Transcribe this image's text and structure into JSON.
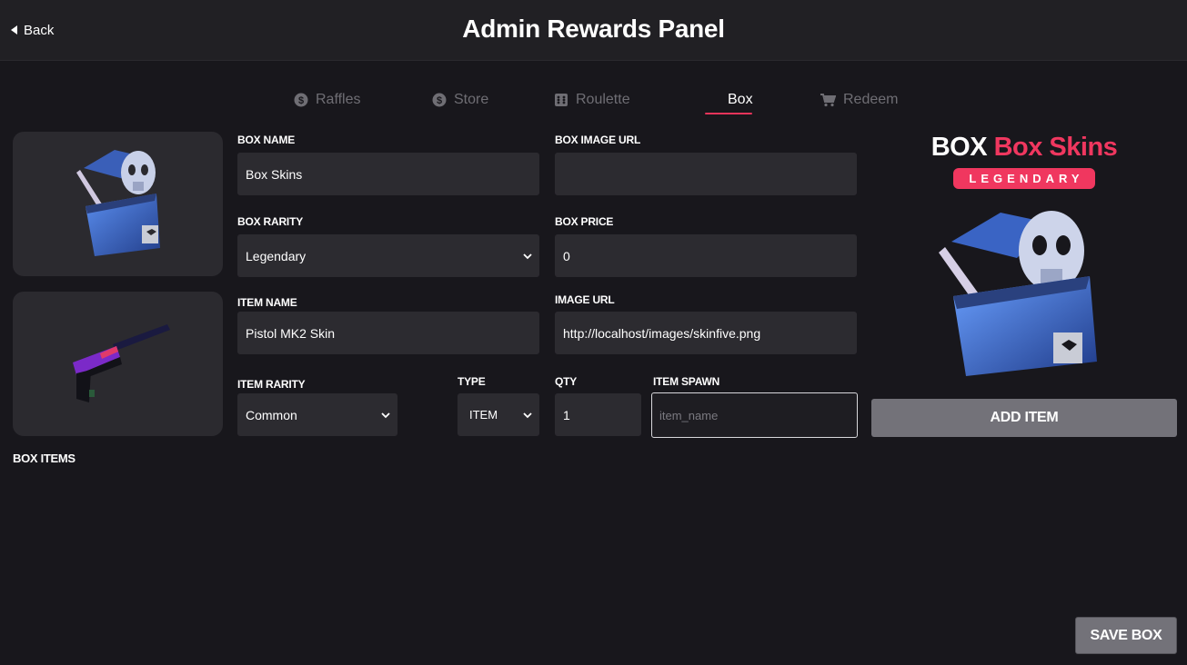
{
  "header": {
    "back_label": "Back",
    "title": "Admin Rewards Panel"
  },
  "tabs": [
    {
      "label": "Raffles",
      "icon": "dollar-coin-icon",
      "active": false
    },
    {
      "label": "Store",
      "icon": "dollar-coin-icon",
      "active": false
    },
    {
      "label": "Roulette",
      "icon": "dice-icon",
      "active": false
    },
    {
      "label": "Box",
      "icon": "",
      "active": true
    },
    {
      "label": "Redeem",
      "icon": "cart-icon",
      "active": false
    }
  ],
  "form": {
    "box_name": {
      "label": "BOX NAME",
      "value": "Box Skins"
    },
    "box_image_url": {
      "label": "BOX IMAGE URL",
      "value": ""
    },
    "box_rarity": {
      "label": "BOX RARITY",
      "value": "Legendary"
    },
    "box_price": {
      "label": "BOX PRICE",
      "value": "0"
    },
    "item_name": {
      "label": "ITEM NAME",
      "value": "Pistol MK2 Skin"
    },
    "image_url": {
      "label": "IMAGE URL",
      "value": "http://localhost/images/skinfive.png"
    },
    "item_rarity": {
      "label": "ITEM RARITY",
      "value": "Common"
    },
    "type": {
      "label": "TYPE",
      "value": "ITEM"
    },
    "qty": {
      "label": "QTY",
      "value": "1"
    },
    "item_spawn": {
      "label": "ITEM SPAWN",
      "placeholder": "item_name"
    }
  },
  "preview": {
    "prefix": "BOX",
    "name": "Box Skins",
    "rarity": "LEGENDARY"
  },
  "buttons": {
    "add_item": "ADD ITEM",
    "save_box": "SAVE BOX"
  },
  "box_items": {
    "title": "BOX ITEMS"
  },
  "colors": {
    "accent": "#f0375f",
    "background": "#18171c",
    "panel": "#2b2a2f",
    "button": "#737279"
  }
}
